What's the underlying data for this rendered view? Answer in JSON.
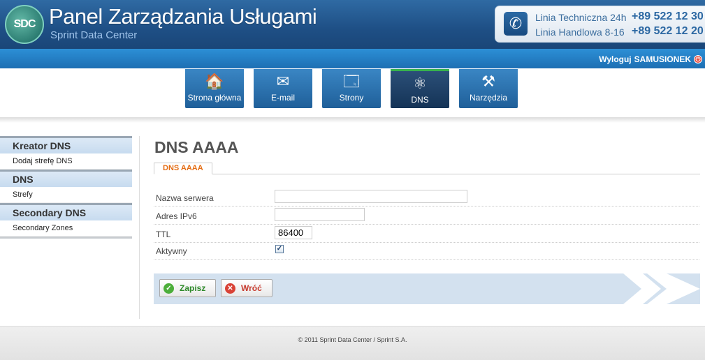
{
  "header": {
    "logo_text": "SDC",
    "title": "Panel Zarządzania Usługami",
    "subtitle": "Sprint Data Center",
    "contact": [
      {
        "label": "Linia Techniczna 24h",
        "number": "+89 522 12 30"
      },
      {
        "label": "Linia Handlowa 8-16",
        "number": "+89 522 12 20"
      }
    ],
    "phone_icon": "phone-icon"
  },
  "topbar": {
    "logout_label": "Wyloguj",
    "username": "SAMUSIONEK",
    "power_icon": "power-icon"
  },
  "nav": {
    "tabs": [
      {
        "label": "Strona główna",
        "icon": "home-icon",
        "glyph": "🏠",
        "active": false
      },
      {
        "label": "E-mail",
        "icon": "envelope-icon",
        "glyph": "✉",
        "active": false
      },
      {
        "label": "Strony",
        "icon": "pages-icon",
        "glyph": "🗔",
        "active": false
      },
      {
        "label": "DNS",
        "icon": "network-icon",
        "glyph": "⚛",
        "active": true
      },
      {
        "label": "Narzędzia",
        "icon": "tools-icon",
        "glyph": "⚒",
        "active": false
      }
    ]
  },
  "sidebar": {
    "sections": [
      {
        "title": "Kreator DNS",
        "items": [
          "Dodaj strefę DNS"
        ]
      },
      {
        "title": "DNS",
        "items": [
          "Strefy"
        ]
      },
      {
        "title": "Secondary DNS",
        "items": [
          "Secondary Zones"
        ]
      }
    ]
  },
  "main": {
    "title": "DNS AAAA",
    "tab_label": "DNS AAAA",
    "form": {
      "server_name_label": "Nazwa serwera",
      "server_name_value": "",
      "ipv6_label": "Adres IPv6",
      "ipv6_value": "",
      "ttl_label": "TTL",
      "ttl_value": "86400",
      "active_label": "Aktywny",
      "active_checked": true
    },
    "buttons": {
      "save_label": "Zapisz",
      "back_label": "Wróć"
    }
  },
  "footer": {
    "copyright": "© 2011 Sprint Data Center / Sprint S.A."
  }
}
